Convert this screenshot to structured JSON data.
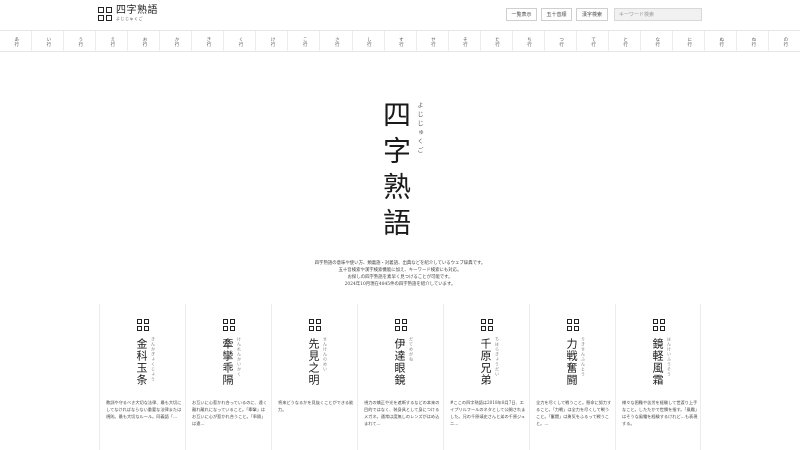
{
  "header": {
    "logo_title": "四字熟語",
    "logo_sub": "よじじゅくご",
    "btn_list": "一覧表示",
    "btn_gojuon": "五十音順",
    "btn_kanji": "漢字検索",
    "search_placeholder": "キーワード検索"
  },
  "kana_nav": [
    "あ行",
    "い行",
    "う行",
    "え行",
    "お行",
    "か行",
    "き行",
    "く行",
    "け行",
    "こ行",
    "さ行",
    "し行",
    "す行",
    "せ行",
    "そ行",
    "た行",
    "ち行",
    "つ行",
    "て行",
    "と行",
    "な行",
    "に行",
    "ぬ行",
    "ね行",
    "の行"
  ],
  "hero": {
    "title": "四字熟語",
    "ruby": "よじじゅくご"
  },
  "intro": [
    "四字熟語の意味や使い方、類義語・対義語、出典などを紹介しているウェブ辞典です。",
    "五十音検索や漢字検索機能に加え、キーワード検索にも対応。",
    "お探しの四字熟語を素早く見つけることが可能です。",
    "2024年10月現在4845件の四字熟語を紹介しています。"
  ],
  "cards": [
    {
      "word": "金科玉条",
      "ruby": "きんかぎょくじょう",
      "desc": "教訓や守るべき大切な法律、最も大切にしてなければならない重要な法律または規則。最も大切なルール。同義語「…"
    },
    {
      "word": "牽攣乖隔",
      "ruby": "けんれんかいかく",
      "desc": "お互いに心惹かれ合っているのに、遠く離れ離れになっていること。「牽攣」はお互いに心が惹かれ合うこと。「乖隔」は遠…"
    },
    {
      "word": "先見之明",
      "ruby": "せんけんのめい",
      "desc": "将来どうなるかを見抜くことができる能力。"
    },
    {
      "word": "伊達眼鏡",
      "ruby": "だてめがね",
      "desc": "視力の矯正や光を遮断するなどの本来の目的ではなく、装身具として身につけるメガネ。通常は度無しのレンズがはめ込まれて…"
    },
    {
      "word": "千原兄弟",
      "ruby": "ちはらきょうだい",
      "desc": "#ここの四字熟語は2018年8月7日、エイプリルフールのネタとして公開されました。兄の千原靖史さんと弟の千原ジュニ…"
    },
    {
      "word": "力戦奮闘",
      "ruby": "りきせんふんとう",
      "desc": "全力を尽くして戦うこと。懸命に努力すること。「力戦」は全力を尽くして戦うこと。「奮闘」は勇気をふるって戦うこと。…"
    },
    {
      "word": "鏡軽風霜",
      "ruby": "はんけいふうそう",
      "desc": "様々な困難や苦労を経験して世渡り上手なこと。したたかで世慣を指す。「風霜」はそうな風霜を経験するけれど…も表現する。"
    }
  ]
}
